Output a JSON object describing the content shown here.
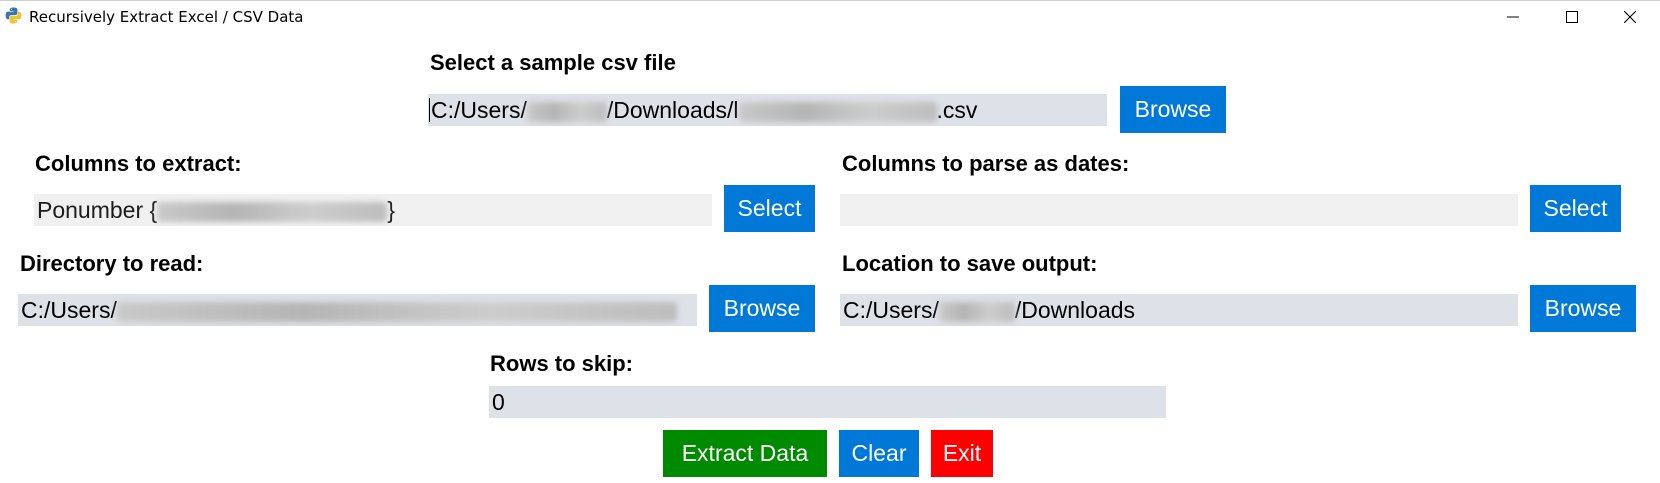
{
  "window": {
    "title": "Recursively Extract Excel / CSV Data",
    "icon": "python-icon"
  },
  "sample_csv": {
    "label": "Select a sample csv file",
    "value_prefix": "C:/Users/",
    "value_mid": "/Downloads/l",
    "value_suffix": ".csv",
    "browse_label": "Browse"
  },
  "columns_extract": {
    "label": "Columns to extract:",
    "value_prefix": "Ponumber {",
    "value_suffix": "}",
    "select_label": "Select"
  },
  "columns_dates": {
    "label": "Columns to parse as dates:",
    "value": "",
    "select_label": "Select"
  },
  "directory_read": {
    "label": "Directory to read:",
    "value_prefix": "C:/Users/",
    "browse_label": "Browse"
  },
  "output_location": {
    "label": "Location to save output:",
    "value_prefix": "C:/Users/",
    "value_suffix": "/Downloads",
    "browse_label": "Browse"
  },
  "rows_skip": {
    "label": "Rows to skip:",
    "value": "0"
  },
  "actions": {
    "extract_label": "Extract Data",
    "clear_label": "Clear",
    "exit_label": "Exit"
  },
  "colors": {
    "accent_blue": "#0078d7",
    "extract_green": "#008a00",
    "exit_red": "#ff0000",
    "entry_bg": "#dde1e8"
  }
}
